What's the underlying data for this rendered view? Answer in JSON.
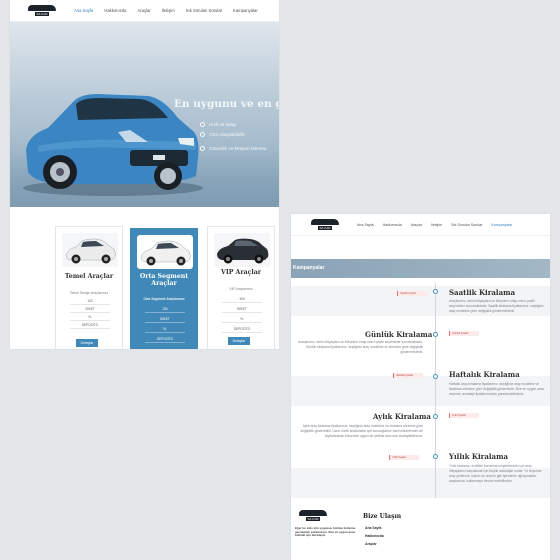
{
  "nav": {
    "logo_text": "SA CAR",
    "items": [
      "Ana Sayfa",
      "Hakkımızda",
      "Araçlar",
      "İletişim",
      "Sık Sorulan Sorular",
      "Kampanyalar"
    ]
  },
  "hero": {
    "title": "En uygunu ve en güv",
    "features": [
      "Hızlı ve kolay",
      "7/24 Ulaşılabilirlik",
      "Güvenilir ve Müşteri Memnu"
    ],
    "colors": {
      "car_body": "#3b86c2",
      "sky": "#dfe6ec"
    }
  },
  "categories": [
    {
      "title": "Temel Araçlar",
      "subtitle": "Temel Seviye Araçlarımız",
      "rows": [
        "100",
        "30KET",
        "YL",
        "DEPOZİTO"
      ],
      "button": "Detaylar",
      "car_color": "#f2f2f2"
    },
    {
      "title": "Orta Segment Araçlar",
      "subtitle": "Orta Segment Araçlarımız",
      "rows": [
        "150",
        "50KET",
        "YL",
        "DEPOZİTO"
      ],
      "button": "Detaylar",
      "car_color": "#f2f2f2"
    },
    {
      "title": "VIP Araçlar",
      "subtitle": "VIP Araçlarımız",
      "rows": [
        "300",
        "80KET",
        "YL",
        "DEPOZİTO"
      ],
      "button": "Detaylar",
      "car_color": "#2a2f35"
    }
  ],
  "campaigns": {
    "banner": "Kampanyalar",
    "items": [
      {
        "title": "Saatlik Kiralama",
        "text": "Araçlarımız, farklı ihtiyaçlara ve bütçelere hitap eden çeşitli seçenekler sunulmaktadır. Saatlik kiralama fiyatlarımız, seçtiğiniz araç modeline göre değişiklik göstermektedir.",
        "tag": "Saatlik fiyatlar",
        "side": "right"
      },
      {
        "title": "Günlük Kiralama",
        "text": "Araçlarımız, farklı ihtiyaçlara ve bütçelere hitap eden çeşitli seçenekler sunulmaktadır. Günlük kiralama fiyatlarımız, seçtiğiniz araç modeline ve süresine göre değişiklik göstermektedir.",
        "tag": "Günlük fiyatlar",
        "side": "left"
      },
      {
        "title": "Haftalık Kiralama",
        "text": "Haftalık araç kiralama fiyatlarımız, seçtiğiniz araç modeline ve kiralama süresine göre değişiklik gösterebilir. Size en uygun aracı seçerek, avantajlı fiyatlarımızdan yararlanabilirsiniz.",
        "tag": "Haftalık fiyatlar",
        "side": "right"
      },
      {
        "title": "Aylık Kiralama",
        "text": "Aylık araç kiralama fiyatlarımız, seçtiğiniz araç modeline ve kiralama süresine göre değişiklik gösterebilir. Uzun süreli kiralamalar için sunduğumuz özel indirimlerden de faydalanarak bütçenize uygun bir şekilde aracınızı kiralayabilirsiniz.",
        "tag": "Aylık fiyatlar",
        "side": "left"
      },
      {
        "title": "Yıllık Kiralama",
        "text": "Yıllık kiralama, özellikle kurumsal müşterilerimiz için araç ihtiyaçlarını karşılamak için büyük avantajlar sunar. Yıl boyunca araç yenileme, bakım ve onarım gibi işlemlerle uğraşmadan, araçlarınızı kullanmaya devam edebilirsiniz.",
        "tag": "Yıllık fiyatlar",
        "side": "right"
      }
    ]
  },
  "footer": {
    "logo_text": "SA CAR",
    "about": "Eğer bu sizin için uygunsa, bizimle iletişime geçmekten çekinmeyin. Size en uygun aracı bulmak için buradayız.",
    "links_title": "Bize Ulaşın",
    "links": [
      "Ana Sayfa",
      "Hakkımızda",
      "Araçlar"
    ]
  }
}
